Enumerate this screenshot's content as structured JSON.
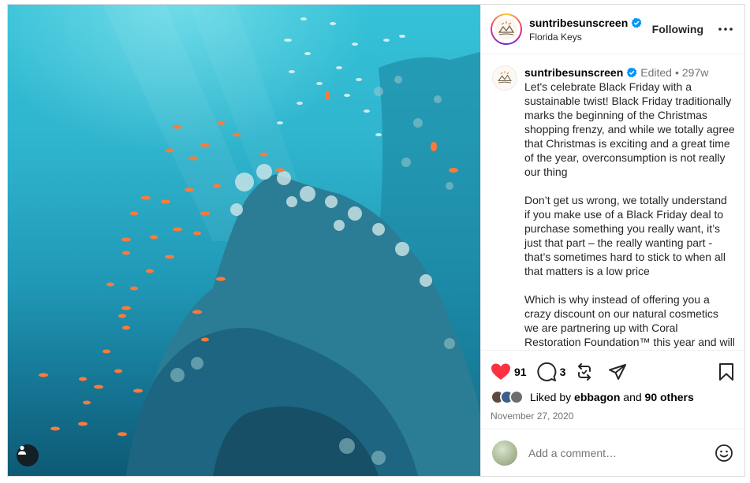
{
  "post": {
    "username": "suntribesunscreen",
    "location": "Florida Keys",
    "follow_label": "Following",
    "caption": {
      "edited_label": "Edited",
      "separator": "•",
      "age": "297w",
      "paragraphs": [
        "Let's celebrate Black Friday with a sustainable twist! Black Friday traditionally marks the beginning of the Christmas shopping frenzy, and while we totally agree that Christmas is exciting and a great time of the year, overconsumption is not really our thing",
        "Don’t get us wrong, we totally understand if you make use of a Black Friday deal to purchase something you really want, it’s just that part – the really wanting part - that’s sometimes hard to stick to when all that matters is a low price",
        "Which is why instead of offering you a crazy discount on our natural cosmetics we are partnering up with Coral Restoration Foundation™ this year and will"
      ]
    },
    "stats": {
      "likes": "91",
      "comments": "3"
    },
    "liked_by": {
      "prefix": "Liked by",
      "user": "ebbagon",
      "joiner": "and",
      "others": "90 others"
    },
    "date": "November 27, 2020",
    "comment_placeholder": "Add a comment…"
  },
  "icons": {
    "verified": "verified-badge-icon",
    "more": "more-options-icon",
    "like": "heart-icon",
    "comment": "comment-icon",
    "share": "repost-icon",
    "send": "send-icon",
    "save": "bookmark-icon",
    "emoji": "emoji-icon",
    "user_tag": "user-tag-icon"
  },
  "colors": {
    "like": "#ff3040",
    "verified": "#0095f6",
    "secondary_text": "#737373"
  }
}
